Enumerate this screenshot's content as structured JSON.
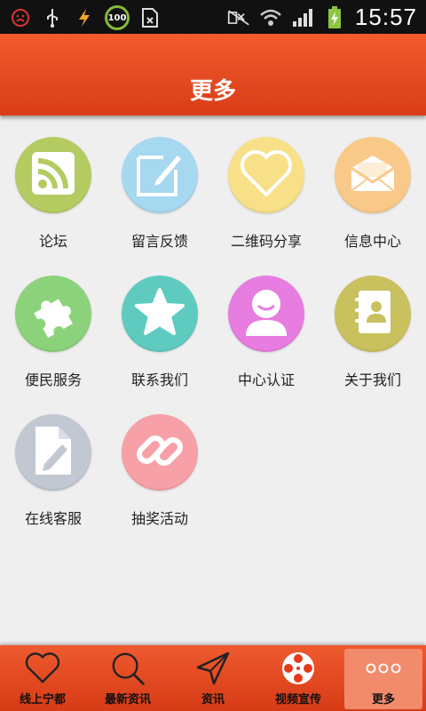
{
  "status_bar": {
    "battery_badge": "100",
    "time": "15:57"
  },
  "header": {
    "title": "更多"
  },
  "grid": {
    "items": [
      {
        "label": "论坛",
        "icon": "rss-icon",
        "color": "#b4cb62"
      },
      {
        "label": "留言反馈",
        "icon": "edit-icon",
        "color": "#a6d8f0"
      },
      {
        "label": "二维码分享",
        "icon": "heart-icon",
        "color": "#f7e088"
      },
      {
        "label": "信息中心",
        "icon": "mail-icon",
        "color": "#f9c98a"
      },
      {
        "label": "便民服务",
        "icon": "puzzle-icon",
        "color": "#8cd27a"
      },
      {
        "label": "联系我们",
        "icon": "star-icon",
        "color": "#5fcbc0"
      },
      {
        "label": "中心认证",
        "icon": "user-icon",
        "color": "#e77de0"
      },
      {
        "label": "关于我们",
        "icon": "contacts-icon",
        "color": "#c9c05e"
      },
      {
        "label": "在线客服",
        "icon": "document-edit-icon",
        "color": "#c1c8d2"
      },
      {
        "label": "抽奖活动",
        "icon": "link-icon",
        "color": "#f7a0a7"
      }
    ]
  },
  "bottom_nav": {
    "items": [
      {
        "label": "线上宁都",
        "icon": "heart-outline-icon"
      },
      {
        "label": "最新资讯",
        "icon": "search-icon"
      },
      {
        "label": "资讯",
        "icon": "send-icon"
      },
      {
        "label": "视频宣传",
        "icon": "film-reel-icon"
      },
      {
        "label": "更多",
        "icon": "more-dots-icon"
      }
    ],
    "active_index": 4
  }
}
